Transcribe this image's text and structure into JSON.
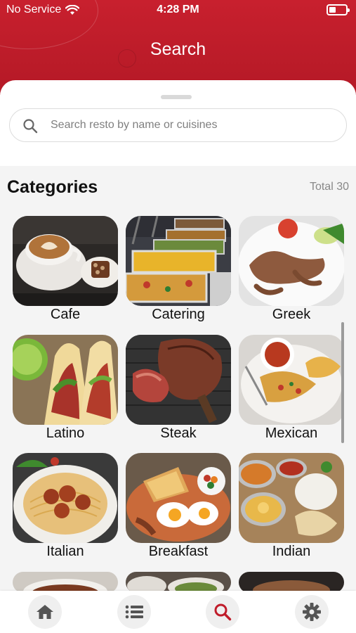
{
  "status_bar": {
    "carrier": "No Service",
    "time": "4:28 PM"
  },
  "header": {
    "title": "Search"
  },
  "search": {
    "placeholder": "Search resto by name or cuisines"
  },
  "categories": {
    "heading": "Categories",
    "total": "Total 30",
    "items": [
      {
        "label": "Cafe"
      },
      {
        "label": "Catering"
      },
      {
        "label": "Greek"
      },
      {
        "label": "Latino"
      },
      {
        "label": "Steak"
      },
      {
        "label": "Mexican"
      },
      {
        "label": "Italian"
      },
      {
        "label": "Breakfast"
      },
      {
        "label": "Indian"
      }
    ]
  },
  "tabbar": {
    "items": [
      {
        "icon": "home-icon"
      },
      {
        "icon": "list-icon"
      },
      {
        "icon": "search-icon",
        "active": true
      },
      {
        "icon": "gear-icon"
      }
    ]
  },
  "colors": {
    "brand": "#c01d2b",
    "active_icon": "#c01d2b",
    "inactive_icon": "#555555"
  }
}
